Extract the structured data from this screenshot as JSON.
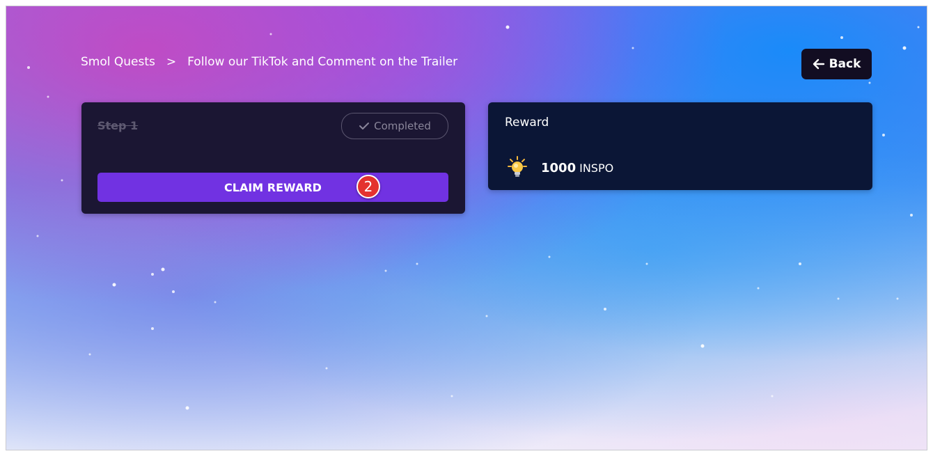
{
  "breadcrumb": {
    "root": "Smol Quests",
    "separator": ">",
    "current": "Follow our TikTok and Comment on the Trailer"
  },
  "back_button": {
    "label": "Back",
    "icon": "arrow-left-icon"
  },
  "step_card": {
    "title": "Step 1",
    "status_label": "Completed",
    "status_icon": "checkmark-icon",
    "claim_label": "CLAIM REWARD",
    "badge_number": "2"
  },
  "reward_card": {
    "title": "Reward",
    "icon": "lightbulb-icon",
    "amount": "1000",
    "unit": "INSPO"
  },
  "colors": {
    "card_dark": "#1b1633",
    "reward_card": "#0b1636",
    "claim_button": "#7132e2",
    "back_button": "#120d22",
    "badge": "#e4322f"
  }
}
